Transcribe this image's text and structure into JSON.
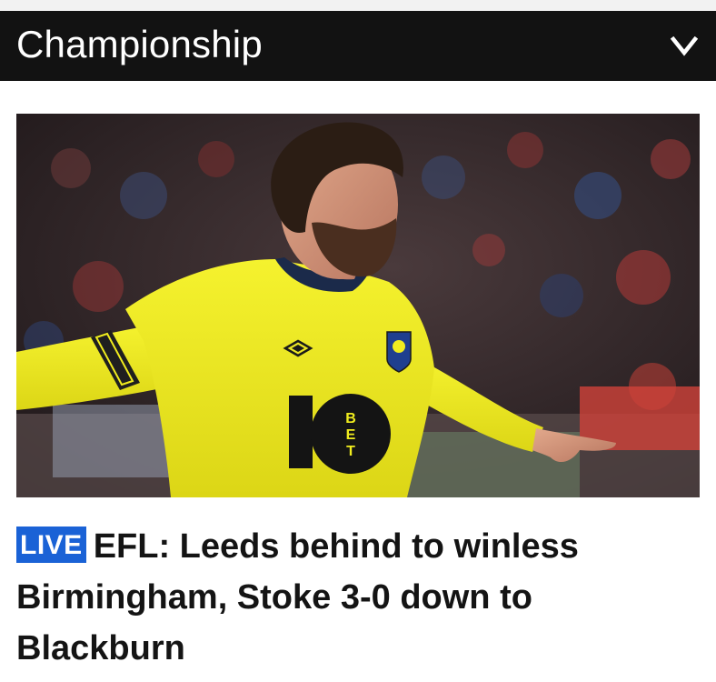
{
  "header": {
    "section_title": "Championship",
    "dropdown_icon": "chevron-down-icon"
  },
  "story": {
    "live_badge": "LIVE",
    "headline": "EFL: Leeds behind to winless Birmingham, Stoke 3-0 down to Blackburn"
  },
  "image": {
    "shirt_sponsor": "10BET",
    "shirt_brand": "umbro"
  },
  "colors": {
    "header_bg": "#121212",
    "live_badge_bg": "#1a62d6",
    "shirt_yellow": "#f0ec1e"
  }
}
